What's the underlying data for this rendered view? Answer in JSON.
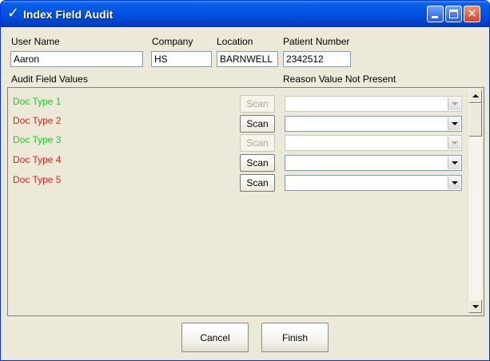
{
  "window": {
    "title": "Index Field Audit",
    "title_check": "✓"
  },
  "header": {
    "user_name_label": "User Name",
    "user_name_value": "Aaron",
    "company_label": "Company",
    "company_value": "HS",
    "location_label": "Location",
    "location_value": "BARNWELL",
    "patient_number_label": "Patient Number",
    "patient_number_value": "2342512"
  },
  "section_labels": {
    "audit_field_values": "Audit Field Values",
    "reason_value_not_present": "Reason Value Not Present"
  },
  "rows": [
    {
      "label": "Doc Type 1",
      "scan_label": "Scan",
      "color": "#22cc22",
      "enabled": false
    },
    {
      "label": "Doc Type 2",
      "scan_label": "Scan",
      "color": "#e02020",
      "enabled": true
    },
    {
      "label": "Doc Type 3",
      "scan_label": "Scan",
      "color": "#22cc22",
      "enabled": false
    },
    {
      "label": "Doc Type 4",
      "scan_label": "Scan",
      "color": "#e02020",
      "enabled": true
    },
    {
      "label": "Doc Type 5",
      "scan_label": "Scan",
      "color": "#e02020",
      "enabled": true
    }
  ],
  "buttons": {
    "cancel": "Cancel",
    "finish": "Finish"
  },
  "colors": {
    "present": "#22cc22",
    "missing": "#e02020",
    "titlebar": "#0054e3"
  }
}
